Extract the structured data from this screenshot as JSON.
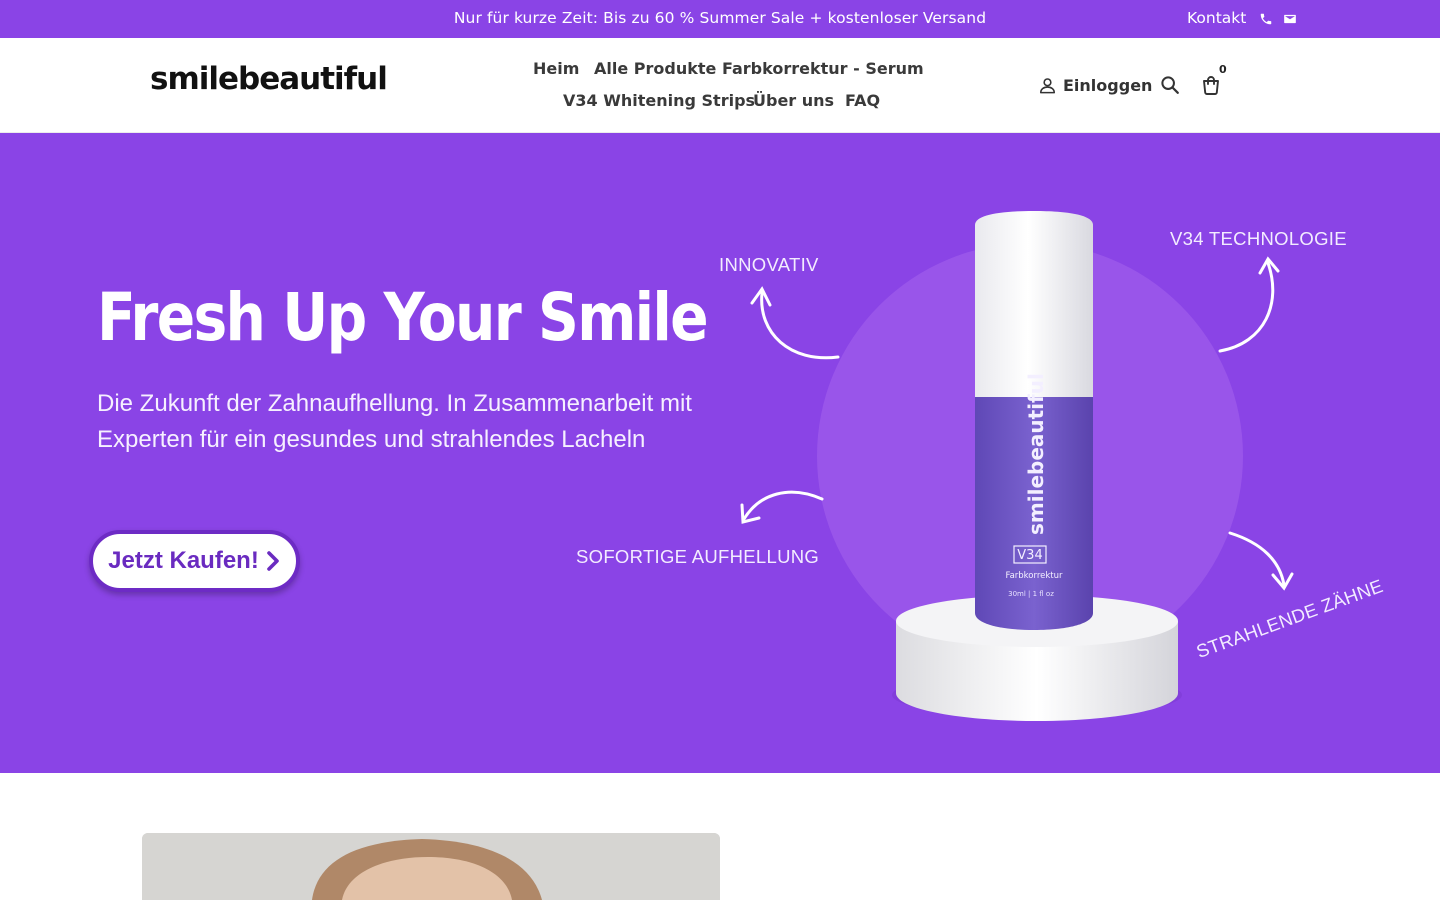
{
  "announcement": {
    "text": "Nur für kurze Zeit: Bis zu 60 % Summer Sale + kostenloser Versand",
    "contact_label": "Kontakt",
    "icons": [
      "phone-icon",
      "mail-icon"
    ]
  },
  "header": {
    "logo": "smilebeautiful",
    "nav": [
      {
        "label": "Heim"
      },
      {
        "label": "Alle Produkte"
      },
      {
        "label": "Farbkorrektur - Serum"
      },
      {
        "label": "V34 Whitening Strips"
      },
      {
        "label": "Über uns"
      },
      {
        "label": "FAQ"
      }
    ],
    "login_label": "Einloggen",
    "cart_count": "0",
    "icons": [
      "user-icon",
      "search-icon",
      "cart-icon"
    ]
  },
  "hero": {
    "title": "Fresh Up Your Smile",
    "subtitle": "Die Zukunft der Zahnaufhellung. In Zusammenarbeit mit Experten für ein gesundes und strahlendes Lacheln",
    "cta_label": "Jetzt Kaufen!",
    "features": [
      "INNOVATIV",
      "V34 TECHNOLOGIE",
      "SOFORTIGE AUFHELLUNG",
      "STRAHLENDE ZÄHNE"
    ],
    "product": {
      "brand": "smilebeautiful",
      "model": "V34",
      "name": "Farbkorrektur",
      "size": "30ml | 1 fl oz"
    }
  },
  "colors": {
    "brand_purple": "#8a44e6",
    "circle_purple": "#9955ea",
    "bottle_purple": "#7158c8",
    "cta_text": "#6a2bc0",
    "white": "#ffffff"
  }
}
